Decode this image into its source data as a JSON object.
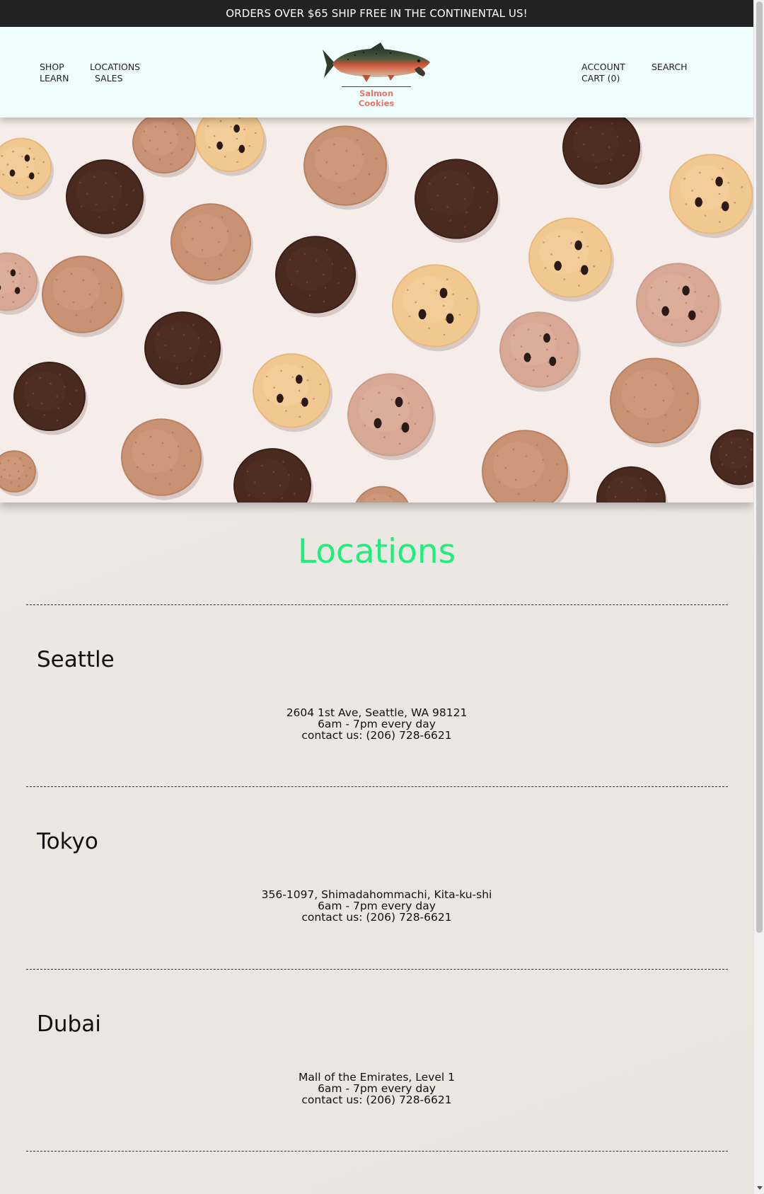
{
  "announcement": "ORDERS OVER $65 SHIP FREE IN THE CONTINENTAL US!",
  "nav": {
    "shop": "SHOP",
    "learn": "LEARN",
    "locations": "LOCATIONS",
    "sales": "SALES",
    "account": "ACCOUNT",
    "cart": "CART (0)",
    "search": "SEARCH"
  },
  "brand": {
    "name": "Salmon Cookies",
    "logo_icon": "salmon-fish-icon",
    "name_color": "#e8766a"
  },
  "hero": {
    "image": "cookies-photo",
    "background": "#f6ecea"
  },
  "locations_section": {
    "title": "Locations",
    "title_color": "#1cf07a",
    "items": [
      {
        "city": "Seattle",
        "address": "2604 1st Ave, Seattle, WA 98121",
        "hours": "6am - 7pm every day",
        "contact": "contact us: (206) 728-6621"
      },
      {
        "city": "Tokyo",
        "address": "356-1097, Shimadahommachi, Kita-ku-shi",
        "hours": "6am - 7pm every day",
        "contact": "contact us: (206) 728-6621"
      },
      {
        "city": "Dubai",
        "address": "Mall of the Emirates, Level 1",
        "hours": "6am - 7pm every day",
        "contact": "contact us: (206) 728-6621"
      }
    ]
  },
  "colors": {
    "announce_bg": "#222222",
    "header_bg": "#effefd",
    "page_bg": "#ebe7e2"
  }
}
